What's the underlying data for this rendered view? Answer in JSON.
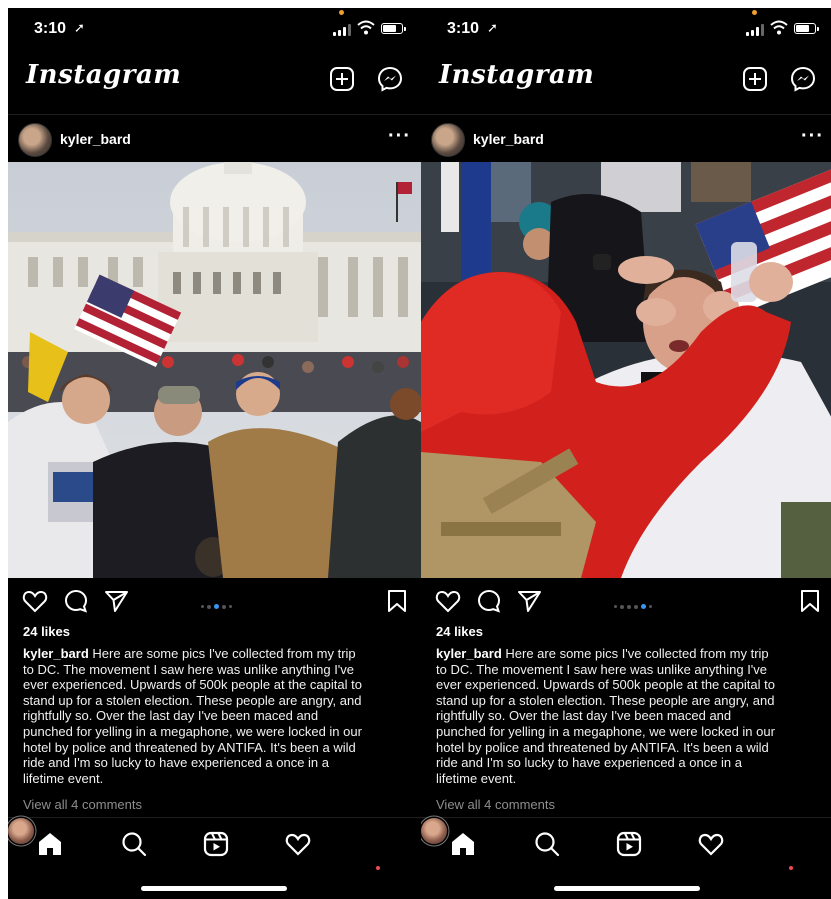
{
  "screens": [
    {
      "status": {
        "time": "3:10",
        "location_icon": "location-arrow-icon"
      },
      "app_title": "Instagram",
      "post": {
        "username": "kyler_bard",
        "more_label": "···",
        "image_description_icon": "photo-capitol-group",
        "likes": "24 likes",
        "caption_user": "kyler_bard",
        "caption_lines": [
          " Here are some pics I've collected from my trip",
          "to DC. The movement I saw here was unlike anything I've",
          "ever experienced. Upwards of 500k people at the capital to",
          "stand up for a stolen election. These people are angry, and",
          "rightfully so. Over the last day I've been maced and",
          "punched for yelling in a megaphone, we were locked in our",
          "hotel by police and threatened by ANTIFA. It's been a wild",
          "ride and I'm so lucky to have experienced a once in a",
          "lifetime event."
        ],
        "view_comments": "View all 4 comments",
        "carousel_active": 3
      }
    },
    {
      "status": {
        "time": "3:10",
        "location_icon": "location-arrow-icon"
      },
      "app_title": "Instagram",
      "post": {
        "username": "kyler_bard",
        "more_label": "···",
        "image_description_icon": "photo-crowd-eyewash",
        "likes": "24 likes",
        "caption_user": "kyler_bard",
        "caption_lines": [
          " Here are some pics I've collected from my trip",
          "to DC. The movement I saw here was unlike anything I've",
          "ever experienced. Upwards of 500k people at the capital to",
          "stand up for a stolen election. These people are angry, and",
          "rightfully so. Over the last day I've been maced and",
          "punched for yelling in a megaphone, we were locked in our",
          "hotel by police and threatened by ANTIFA. It's been a wild",
          "ride and I'm so lucky to have experienced a once in a",
          "lifetime event."
        ],
        "view_comments": "View all 4 comments",
        "carousel_active": 5
      }
    }
  ],
  "colors": {
    "background": "#000000",
    "accent_dot": "#3897f0",
    "muted_text": "#8e8e8e",
    "notification": "#ed4956"
  },
  "icons": {
    "top_bar": [
      "new-post-icon",
      "messenger-icon"
    ],
    "post_actions": [
      "heart-icon",
      "comment-icon",
      "share-icon",
      "bookmark-icon"
    ],
    "bottom_nav": [
      "home-icon",
      "search-icon",
      "reels-icon",
      "activity-heart-icon",
      "profile-avatar"
    ]
  }
}
